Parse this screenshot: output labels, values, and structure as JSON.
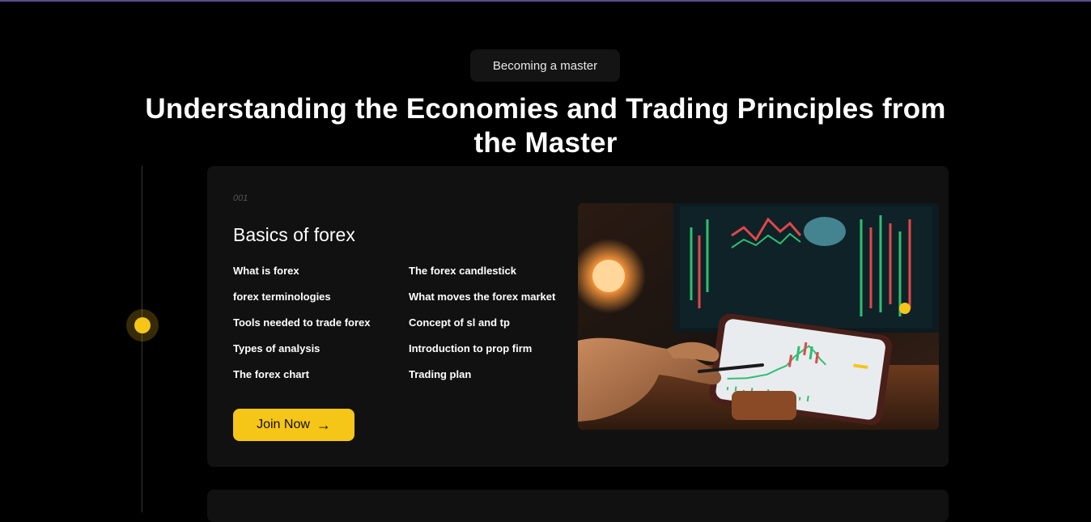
{
  "section": {
    "eyebrow": "Becoming a master",
    "headline": "Understanding the Economies and Trading Principles from the Master"
  },
  "course": {
    "number": "001",
    "title": "Basics of forex",
    "topics": [
      "What is forex",
      "The forex candlestick",
      "forex terminologies",
      "What moves the forex market",
      "Tools needed to trade forex",
      "Concept of sl and tp",
      "Types of analysis",
      "Introduction to prop firm",
      "The forex chart",
      "Trading plan"
    ],
    "cta_label": "Join Now",
    "cta_icon": "arrow-right-icon",
    "image_icon": "trading-photo"
  },
  "colors": {
    "background": "#000000",
    "card": "#111111",
    "accent": "#f5c518"
  }
}
